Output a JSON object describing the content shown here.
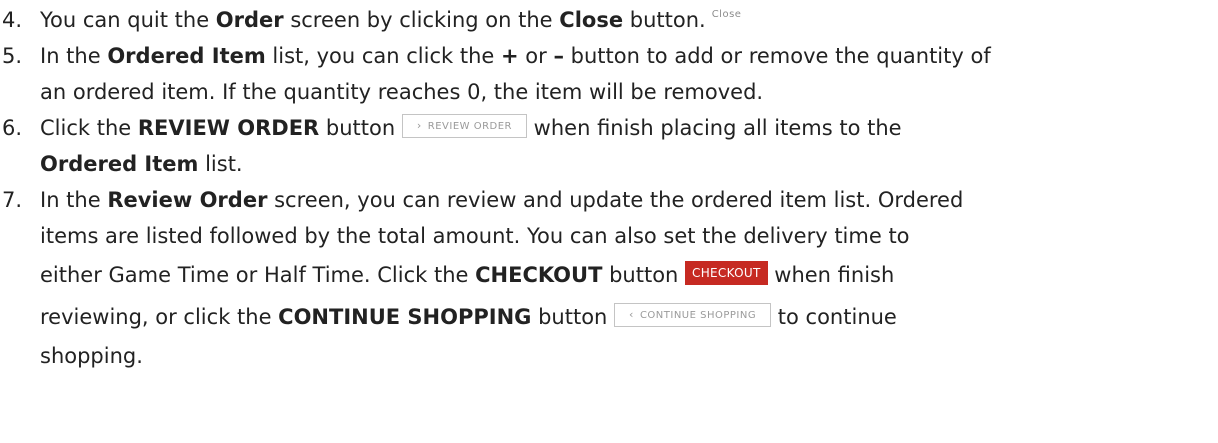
{
  "steps": [
    {
      "num": "4.",
      "t1": "You can quit the ",
      "b1": "Order",
      "t2": " screen by clicking on the ",
      "b2": "Close",
      "t3": " button.",
      "btn": "Close"
    },
    {
      "num": "5.",
      "t1": "In the ",
      "b1": "Ordered Item",
      "t2": " list, you can click the ",
      "b2": "+",
      "t3": " or ",
      "b3": "–",
      "t4": " button to add or remove the quantity of",
      "l2": "an ordered item.  If the quantity reaches 0, the item will be removed."
    },
    {
      "num": "6.",
      "t1": "Click the ",
      "b1": "REVIEW ORDER",
      "t2": " button ",
      "btn_icon": "›",
      "btn": "REVIEW ORDER",
      "t3": " when finish placing all items to the",
      "b2": "Ordered Item",
      "t4": " list."
    },
    {
      "num": "7.",
      "t1": "In the ",
      "b1": "Review Order",
      "t2": " screen, you can review and update the ordered item list.  Ordered",
      "l2": "items are listed followed by the total amount.  You can also set the delivery time to",
      "l3a": "either Game Time or Half Time.  Click the ",
      "b2": "CHECKOUT",
      "l3b": " button ",
      "btn_checkout": "CHECKOUT",
      "l3c": " when finish",
      "l4a": "reviewing, or click the ",
      "b3": "CONTINUE SHOPPING",
      "l4b": " button ",
      "btn_continue_icon": "‹",
      "btn_continue": "CONTINUE SHOPPING",
      "l4c": " to continue",
      "l5": "shopping."
    }
  ],
  "colors": {
    "checkout_button": "#c62a22",
    "outline_button_border": "#c4c4c4",
    "text": "#222222"
  }
}
